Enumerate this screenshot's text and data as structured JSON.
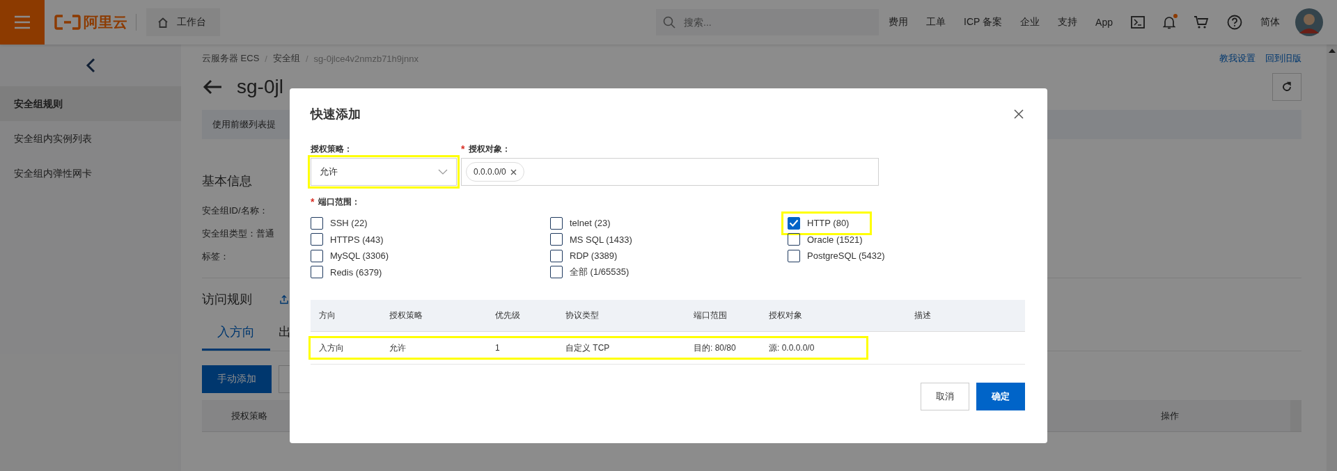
{
  "topbar": {
    "logo": "阿里云",
    "workbench": "工作台",
    "search_placeholder": "搜索...",
    "nav": [
      "费用",
      "工单",
      "ICP 备案",
      "企业",
      "支持",
      "App"
    ],
    "has_notification": true,
    "language": "简体"
  },
  "sidebar": {
    "items": [
      {
        "label": "安全组规则",
        "selected": true
      },
      {
        "label": "安全组内实例列表",
        "selected": false
      },
      {
        "label": "安全组内弹性网卡",
        "selected": false
      }
    ]
  },
  "page": {
    "breadcrumb": [
      "云服务器 ECS",
      "安全组",
      "sg-0jlce4v2nmzb71h9jnnx"
    ],
    "breadcrumb_separator": "/",
    "links": [
      "教我设置",
      "回到旧版"
    ],
    "title": "sg-0jl",
    "notice": "使用前缀列表提",
    "basic_info": {
      "heading": "基本信息",
      "fields": [
        "安全组ID/名称：",
        "安全组类型：普通",
        "标签："
      ]
    },
    "rules": {
      "heading": "访问规则",
      "tabs": [
        {
          "label": "入方向",
          "selected": true
        },
        {
          "label": "出",
          "selected": false
        }
      ],
      "add_button": "手动添加",
      "columns": [
        "授权策略",
        "操作"
      ]
    }
  },
  "dialog": {
    "title": "快速添加",
    "policy": {
      "label": "授权策略：",
      "value": "允许",
      "highlighted": true
    },
    "target": {
      "label": "授权对象：",
      "required_mark": "*",
      "tags": [
        "0.0.0.0/0"
      ]
    },
    "ports": {
      "label": "端口范围：",
      "required_mark": "*",
      "options": [
        {
          "label": "SSH (22)",
          "checked": false,
          "highlighted": false
        },
        {
          "label": "telnet (23)",
          "checked": false,
          "highlighted": false
        },
        {
          "label": "HTTP (80)",
          "checked": true,
          "highlighted": true
        },
        {
          "label": "HTTPS (443)",
          "checked": false,
          "highlighted": false
        },
        {
          "label": "MS SQL (1433)",
          "checked": false,
          "highlighted": false
        },
        {
          "label": "Oracle (1521)",
          "checked": false,
          "highlighted": false
        },
        {
          "label": "MySQL (3306)",
          "checked": false,
          "highlighted": false
        },
        {
          "label": "RDP (3389)",
          "checked": false,
          "highlighted": false
        },
        {
          "label": "PostgreSQL (5432)",
          "checked": false,
          "highlighted": false
        },
        {
          "label": "Redis (6379)",
          "checked": false,
          "highlighted": false
        },
        {
          "label": "全部 (1/65535)",
          "checked": false,
          "highlighted": false
        }
      ]
    },
    "preview": {
      "columns": [
        "方向",
        "授权策略",
        "优先级",
        "协议类型",
        "端口范围",
        "授权对象",
        "描述"
      ],
      "rows": [
        {
          "cells": [
            "入方向",
            "允许",
            "1",
            "自定义 TCP",
            "目的: 80/80",
            "源: 0.0.0.0/0"
          ],
          "highlighted": true
        }
      ]
    },
    "buttons": [
      {
        "label": "取消",
        "primary": false
      },
      {
        "label": "确定",
        "primary": true
      }
    ]
  }
}
